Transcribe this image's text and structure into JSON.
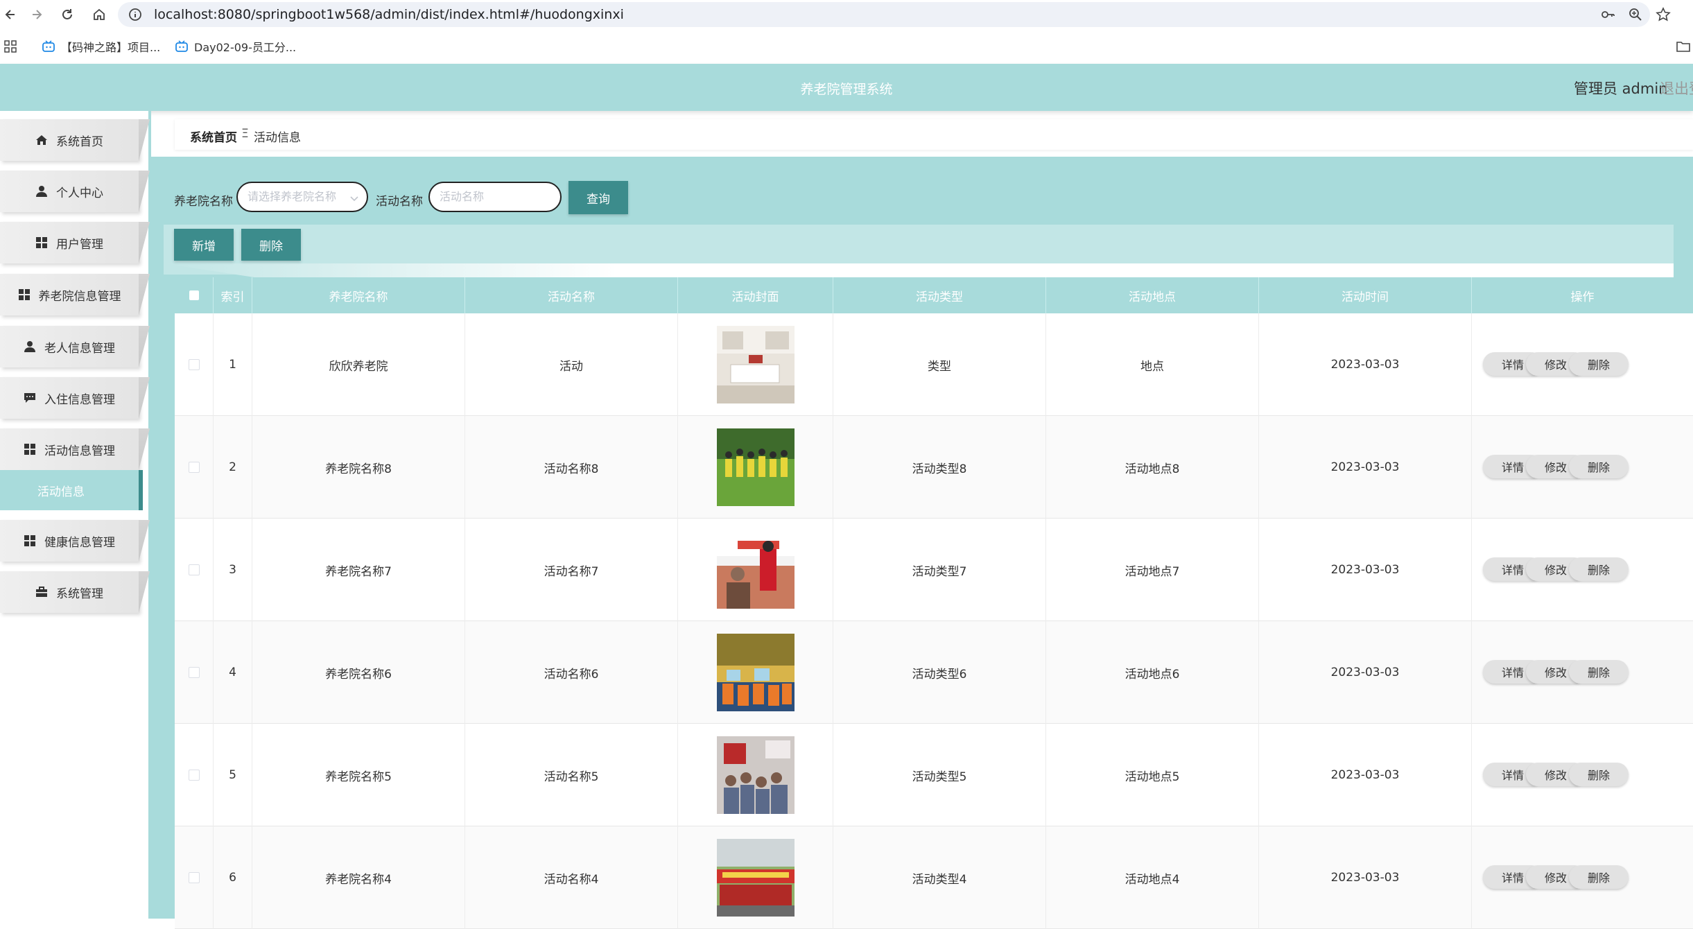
{
  "browser": {
    "url": "localhost:8080/springboot1w568/admin/dist/index.html#/huodongxinxi",
    "bookmarks": [
      {
        "label": "【码神之路】项目..."
      },
      {
        "label": "Day02-09-员工分..."
      }
    ]
  },
  "header": {
    "title": "养老院管理系统",
    "user": "管理员 admin",
    "logout": "退出登"
  },
  "sidebar": {
    "items": [
      {
        "label": "系统首页",
        "icon": "home-icon"
      },
      {
        "label": "个人中心",
        "icon": "user-icon"
      },
      {
        "label": "用户管理",
        "icon": "grid-icon"
      },
      {
        "label": "养老院信息管理",
        "icon": "grid-icon"
      },
      {
        "label": "老人信息管理",
        "icon": "user-icon"
      },
      {
        "label": "入住信息管理",
        "icon": "chat-icon"
      },
      {
        "label": "活动信息管理",
        "icon": "grid-icon"
      },
      {
        "label": "健康信息管理",
        "icon": "grid-icon"
      },
      {
        "label": "系统管理",
        "icon": "briefcase-icon"
      }
    ],
    "active_sub": "活动信息"
  },
  "breadcrumb": {
    "home": "系统首页",
    "separator": "Ξ",
    "current": "活动信息"
  },
  "search": {
    "label1": "养老院名称",
    "placeholder1": "请选择养老院名称",
    "label2": "活动名称",
    "placeholder2": "活动名称",
    "query": "查询"
  },
  "actions": {
    "add": "新增",
    "delete": "删除"
  },
  "table": {
    "columns": [
      "索引",
      "养老院名称",
      "活动名称",
      "活动封面",
      "活动类型",
      "活动地点",
      "活动时间",
      "操作"
    ],
    "op_labels": {
      "detail": "详情",
      "edit": "修改",
      "delete": "删除"
    },
    "rows": [
      {
        "index": "1",
        "home": "欣欣养老院",
        "name": "活动",
        "type": "类型",
        "place": "地点",
        "time": "2023-03-03"
      },
      {
        "index": "2",
        "home": "养老院名称8",
        "name": "活动名称8",
        "type": "活动类型8",
        "place": "活动地点8",
        "time": "2023-03-03"
      },
      {
        "index": "3",
        "home": "养老院名称7",
        "name": "活动名称7",
        "type": "活动类型7",
        "place": "活动地点7",
        "time": "2023-03-03"
      },
      {
        "index": "4",
        "home": "养老院名称6",
        "name": "活动名称6",
        "type": "活动类型6",
        "place": "活动地点6",
        "time": "2023-03-03"
      },
      {
        "index": "5",
        "home": "养老院名称5",
        "name": "活动名称5",
        "type": "活动类型5",
        "place": "活动地点5",
        "time": "2023-03-03"
      },
      {
        "index": "6",
        "home": "养老院名称4",
        "name": "活动名称4",
        "type": "活动类型4",
        "place": "活动地点4",
        "time": "2023-03-03"
      }
    ]
  },
  "colors": {
    "teal": "#a8dbdb",
    "teal_dark": "#3c8c8c",
    "teal_light": "#c2e6e6"
  }
}
